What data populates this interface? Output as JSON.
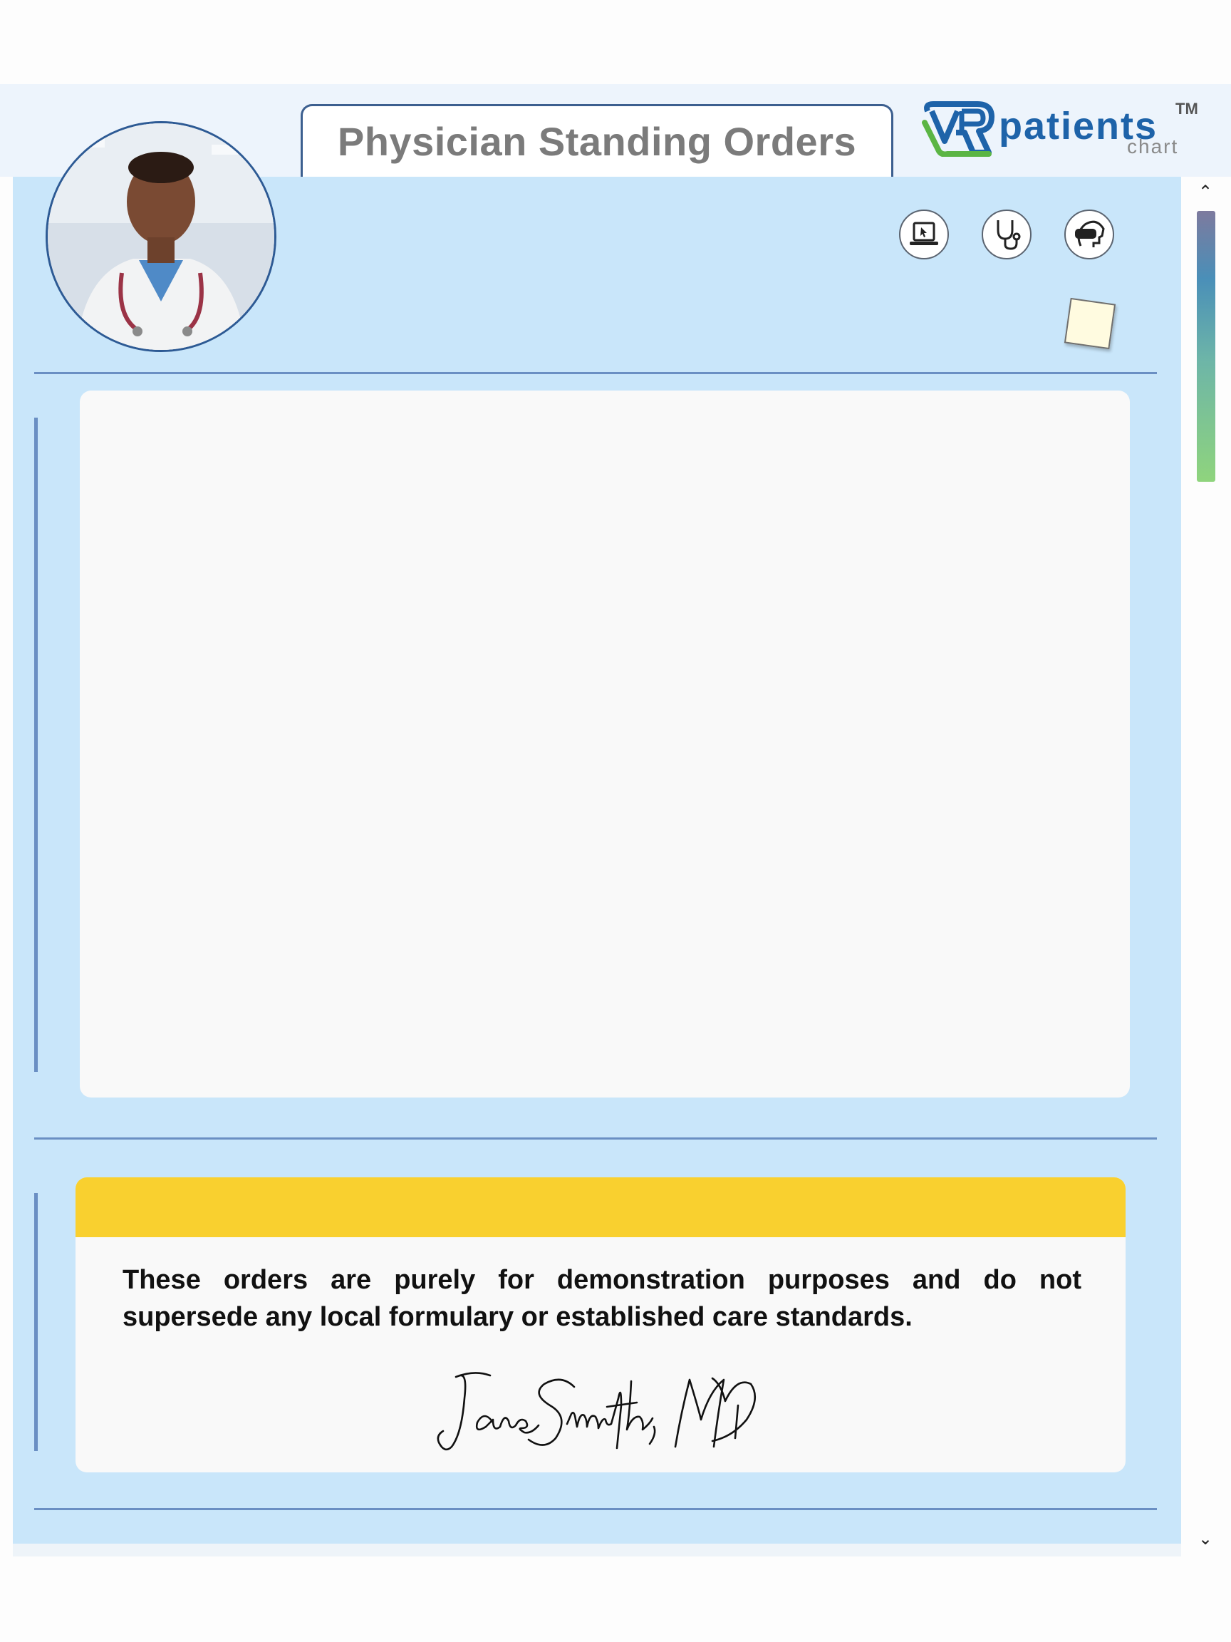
{
  "header": {
    "title": "Physician Standing Orders",
    "logo": {
      "brand": "VRpatients",
      "sub": "chart",
      "trademark": "TM"
    }
  },
  "avatar": {
    "alt": "Physician photo"
  },
  "toolbar": {
    "icons": [
      "laptop-cursor-icon",
      "stethoscope-icon",
      "vr-headset-icon"
    ],
    "sticky_note": "sticky-note"
  },
  "notice": {
    "text": "These orders are purely for demonstration purposes and do not supersede any local formulary or established care standards.",
    "signature": "Jane Smith, MD"
  },
  "colors": {
    "panel": "#c9e6fa",
    "accent_line": "#6a8fc3",
    "notice_bar": "#f9d02f",
    "title_text": "#7b7b7b",
    "brand_blue": "#1e63a9",
    "brand_green": "#5bb544"
  }
}
